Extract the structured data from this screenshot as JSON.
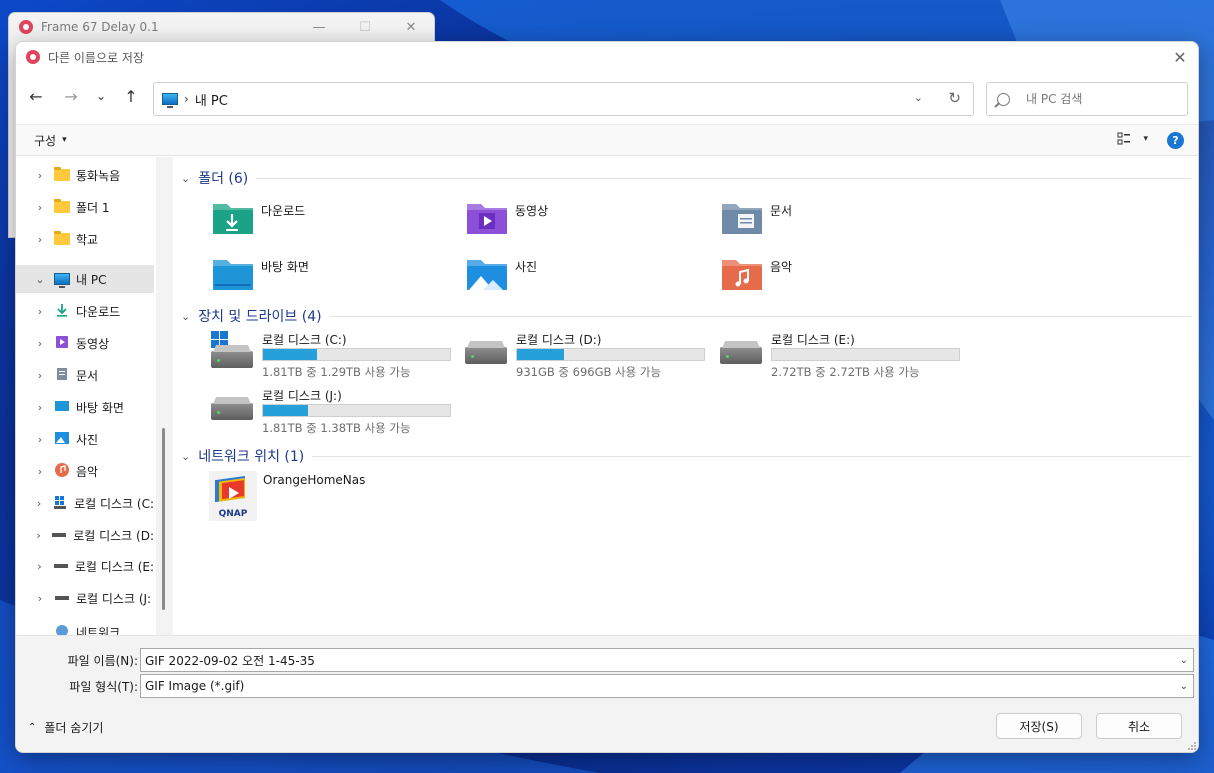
{
  "background_window": {
    "title": "Frame 67 Delay 0.1",
    "minimize": "—",
    "maximize": "☐",
    "close": "✕"
  },
  "dialog": {
    "title": "다른 이름으로 저장",
    "close": "✕"
  },
  "navigation": {
    "back": "←",
    "forward": "→",
    "recent": "⌄",
    "up": "↑",
    "breadcrumb_separator": "›",
    "address": "내 PC",
    "address_dropdown": "⌄",
    "refresh": "↻",
    "search_placeholder": "내 PC 검색"
  },
  "toolbar": {
    "organize_label": "구성",
    "organize_caret": "▾",
    "view_caret": "▾",
    "help": "?"
  },
  "sidebar": {
    "items": [
      {
        "label": "통화녹음",
        "icon": "folder-icon"
      },
      {
        "label": "폴더 1",
        "icon": "folder-icon"
      },
      {
        "label": "학교",
        "icon": "folder-icon"
      },
      {
        "label": "내 PC",
        "icon": "pc-icon"
      },
      {
        "label": "다운로드",
        "icon": "download-icon"
      },
      {
        "label": "동영상",
        "icon": "video-icon"
      },
      {
        "label": "문서",
        "icon": "document-icon"
      },
      {
        "label": "바탕 화면",
        "icon": "desktop-icon"
      },
      {
        "label": "사진",
        "icon": "picture-icon"
      },
      {
        "label": "음악",
        "icon": "music-icon"
      },
      {
        "label": "로컬 디스크 (C:",
        "icon": "windows-drive-icon"
      },
      {
        "label": "로컬 디스크 (D:",
        "icon": "drive-icon"
      },
      {
        "label": "로컬 디스크 (E:",
        "icon": "drive-icon"
      },
      {
        "label": "로컬 디스크 (J:",
        "icon": "drive-icon"
      },
      {
        "label": "네트워크",
        "icon": "network-icon"
      }
    ],
    "chevron_right": "›",
    "chevron_down": "⌄"
  },
  "content": {
    "folders_header": "폴더 (6)",
    "folders": [
      {
        "label": "다운로드",
        "color": "#1aa386"
      },
      {
        "label": "동영상",
        "color": "#8b4fd8"
      },
      {
        "label": "문서",
        "color": "#6e8aa7"
      },
      {
        "label": "바탕 화면",
        "color": "#1d95d6"
      },
      {
        "label": "사진",
        "color": "#1e8fe0"
      },
      {
        "label": "음악",
        "color": "#e56b4a"
      }
    ],
    "drives_header": "장치 및 드라이브 (4)",
    "drives": [
      {
        "name": "로컬 디스크 (C:)",
        "free": "1.81TB 중 1.29TB 사용 가능",
        "used_fraction": 0.29
      },
      {
        "name": "로컬 디스크 (D:)",
        "free": "931GB 중 696GB 사용 가능",
        "used_fraction": 0.25
      },
      {
        "name": "로컬 디스크 (E:)",
        "free": "2.72TB 중 2.72TB 사용 가능",
        "used_fraction": 0.0
      },
      {
        "name": "로컬 디스크 (J:)",
        "free": "1.81TB 중 1.38TB 사용 가능",
        "used_fraction": 0.24
      }
    ],
    "network_header": "네트워크 위치 (1)",
    "network": [
      {
        "label": "OrangeHomeNas",
        "logo_text": "QNAP"
      }
    ]
  },
  "bottom": {
    "filename_label": "파일 이름(N):",
    "filename_value": "GIF 2022-09-02 오전 1-45-35",
    "filetype_label": "파일 형식(T):",
    "filetype_value": "GIF Image (*.gif)",
    "dropdown_caret": "⌄",
    "hide_folders_label": "폴더 숨기기",
    "hide_folders_caret": "⌃",
    "save_button": "저장(S)",
    "cancel_button": "취소"
  },
  "colors": {
    "accent": "#1976d2",
    "progress": "#26a0da",
    "section_header": "#1e3a8a"
  }
}
